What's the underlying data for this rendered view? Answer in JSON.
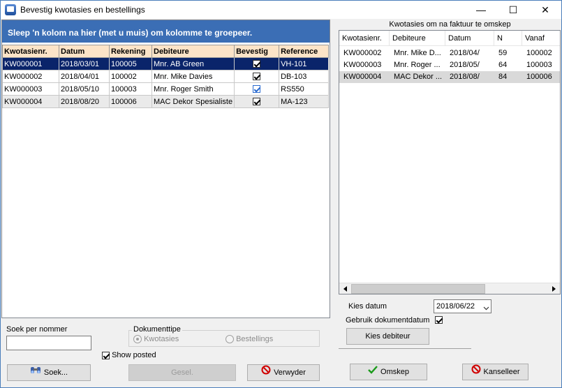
{
  "window": {
    "title": "Bevestig kwotasies en bestellings",
    "minimize": "—",
    "maximize": "☐",
    "close": "✕"
  },
  "left": {
    "group_hint": "Sleep 'n kolom na hier (met u muis) om kolomme te groepeer.",
    "columns": [
      "Kwotasienr.",
      "Datum",
      "Rekening",
      "Debiteure",
      "Bevestig",
      "Reference"
    ],
    "rows": [
      {
        "kwotasienr": "KW000001",
        "datum": "2018/03/01",
        "rekening": "100005",
        "debiteure": "Mnr. AB Green",
        "bevestig": true,
        "reference": "VH-101"
      },
      {
        "kwotasienr": "KW000002",
        "datum": "2018/04/01",
        "rekening": "100002",
        "debiteure": "Mnr. Mike Davies",
        "bevestig": true,
        "reference": "DB-103"
      },
      {
        "kwotasienr": "KW000003",
        "datum": "2018/05/10",
        "rekening": "100003",
        "debiteure": "Mnr. Roger Smith",
        "bevestig": true,
        "reference": "RS550"
      },
      {
        "kwotasienr": "KW000004",
        "datum": "2018/08/20",
        "rekening": "100006",
        "debiteure": "MAC Dekor Spesialiste",
        "bevestig": true,
        "reference": "MA-123"
      }
    ]
  },
  "search": {
    "label": "Soek per nommer",
    "value": ""
  },
  "doctype": {
    "label": "Dokumenttipe",
    "option_quotes": "Kwotasies",
    "option_orders": "Bestellings",
    "selected": "Kwotasies"
  },
  "show_posted": {
    "label": "Show posted",
    "checked": true
  },
  "buttons": {
    "search": "Soek...",
    "gesel": "Gesel.",
    "delete": "Verwyder",
    "convert": "Omskep",
    "cancel": "Kanselleer",
    "choose_debtor": "Kies debiteur"
  },
  "right": {
    "caption": "Kwotasies om na faktuur te omskep",
    "columns": [
      "Kwotasienr.",
      "Debiteure",
      "Datum",
      "N",
      "Vanaf"
    ],
    "rows": [
      {
        "kwotasienr": "KW000002",
        "debiteure": "Mnr. Mike D...",
        "datum": "2018/04/",
        "n": "59",
        "vanaf": "100002"
      },
      {
        "kwotasienr": "KW000003",
        "debiteure": "Mnr. Roger ...",
        "datum": "2018/05/",
        "n": "64",
        "vanaf": "100003"
      },
      {
        "kwotasienr": "KW000004",
        "debiteure": "MAC Dekor ...",
        "datum": "2018/08/",
        "n": "84",
        "vanaf": "100006"
      }
    ],
    "date_label": "Kies datum",
    "date_value": "2018/06/22",
    "use_docdate_label": "Gebruik dokumentdatum",
    "use_docdate_checked": true
  }
}
